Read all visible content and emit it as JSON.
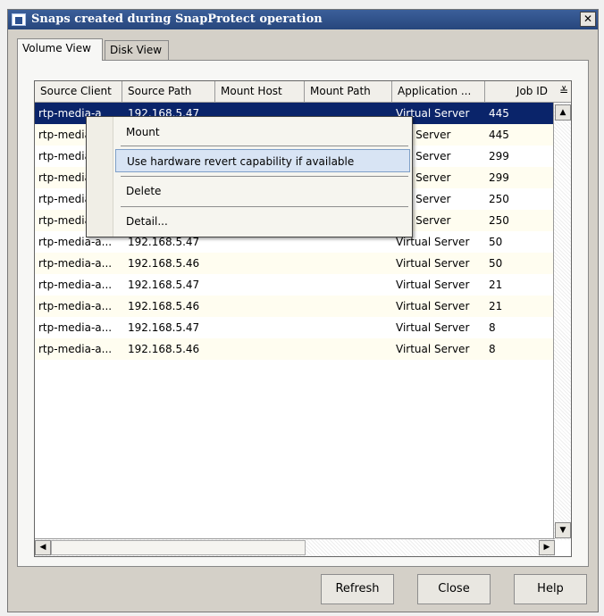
{
  "window": {
    "title": "Snaps created during SnapProtect operation",
    "close_glyph": "✕"
  },
  "tabs": [
    {
      "label": "Volume View",
      "active": true
    },
    {
      "label": "Disk View",
      "active": false
    }
  ],
  "table": {
    "columns": [
      "Source Client",
      "Source Path",
      "Mount Host",
      "Mount Path",
      "Application ...",
      "Job ID"
    ],
    "column_menu_glyph": "≚",
    "rows": [
      {
        "client": "rtp-media-a",
        "path": "192.168.5.47",
        "host": "",
        "mpath": "",
        "app": "Virtual Server",
        "job": "445"
      },
      {
        "client": "rtp-media",
        "path": "",
        "host": "",
        "mpath": "",
        "app": "ual Server",
        "job": "445"
      },
      {
        "client": "rtp-media",
        "path": "",
        "host": "",
        "mpath": "",
        "app": "ual Server",
        "job": "299"
      },
      {
        "client": "rtp-media",
        "path": "",
        "host": "",
        "mpath": "",
        "app": "ual Server",
        "job": "299"
      },
      {
        "client": "rtp-media",
        "path": "",
        "host": "",
        "mpath": "",
        "app": "ual Server",
        "job": "250"
      },
      {
        "client": "rtp-media",
        "path": "",
        "host": "",
        "mpath": "",
        "app": "ual Server",
        "job": "250"
      },
      {
        "client": "rtp-media-a...",
        "path": "192.168.5.47",
        "host": "",
        "mpath": "",
        "app": "Virtual Server",
        "job": "50"
      },
      {
        "client": "rtp-media-a...",
        "path": "192.168.5.46",
        "host": "",
        "mpath": "",
        "app": "Virtual Server",
        "job": "50"
      },
      {
        "client": "rtp-media-a...",
        "path": "192.168.5.47",
        "host": "",
        "mpath": "",
        "app": "Virtual Server",
        "job": "21"
      },
      {
        "client": "rtp-media-a...",
        "path": "192.168.5.46",
        "host": "",
        "mpath": "",
        "app": "Virtual Server",
        "job": "21"
      },
      {
        "client": "rtp-media-a...",
        "path": "192.168.5.47",
        "host": "",
        "mpath": "",
        "app": "Virtual Server",
        "job": "8"
      },
      {
        "client": "rtp-media-a...",
        "path": "192.168.5.46",
        "host": "",
        "mpath": "",
        "app": "Virtual Server",
        "job": "8"
      }
    ]
  },
  "context_menu": {
    "items": [
      {
        "label": "Mount"
      },
      {
        "label": "Use hardware revert capability if available"
      },
      {
        "label": "Delete"
      },
      {
        "label": "Detail..."
      }
    ]
  },
  "buttons": {
    "refresh": "Refresh",
    "close": "Close",
    "help": "Help"
  },
  "scroll_glyphs": {
    "up": "▲",
    "down": "▼",
    "left": "◀",
    "right": "▶"
  },
  "colors": {
    "selection": "#0a246a",
    "titlebar": "#27467c",
    "menu_highlight": "#d8e4f4"
  }
}
